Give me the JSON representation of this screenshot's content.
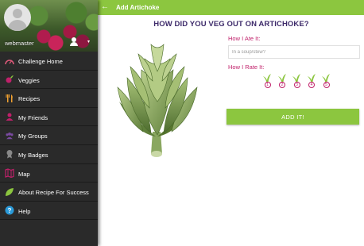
{
  "topbar": {
    "title": "Add Artichoke",
    "back_icon": "arrow-left-icon",
    "color": "#8cc63f"
  },
  "drawer": {
    "username": "webmaster",
    "items": [
      {
        "label": "Challenge Home",
        "icon": "gauge-icon",
        "icon_color": "#e05a7a"
      },
      {
        "label": "Veggies",
        "icon": "radish-icon",
        "icon_color": "#c0206a"
      },
      {
        "label": "Recipes",
        "icon": "utensils-icon",
        "icon_color": "#f0a030"
      },
      {
        "label": "My Friends",
        "icon": "user-icon",
        "icon_color": "#c0206a"
      },
      {
        "label": "My Groups",
        "icon": "group-icon",
        "icon_color": "#7a4aa0"
      },
      {
        "label": "My Badges",
        "icon": "badge-icon",
        "icon_color": "#888888"
      },
      {
        "label": "Map",
        "icon": "map-icon",
        "icon_color": "#c0206a"
      },
      {
        "label": "About Recipe For Success",
        "icon": "leaf-icon",
        "icon_color": "#8cc63f"
      },
      {
        "label": "Help",
        "icon": "help-icon",
        "icon_color": "#2a9ad8"
      }
    ]
  },
  "main": {
    "question": "HOW DID YOU VEG OUT ON ARTICHOKE?",
    "ate_label": "How I Ate It:",
    "ate_placeholder": "In a soup/stew?",
    "rate_label": "How I Rate It:",
    "ratings": [
      "1",
      "2",
      "3",
      "4",
      "5"
    ],
    "add_button": "ADD IT!",
    "accent_color": "#c0206a"
  }
}
